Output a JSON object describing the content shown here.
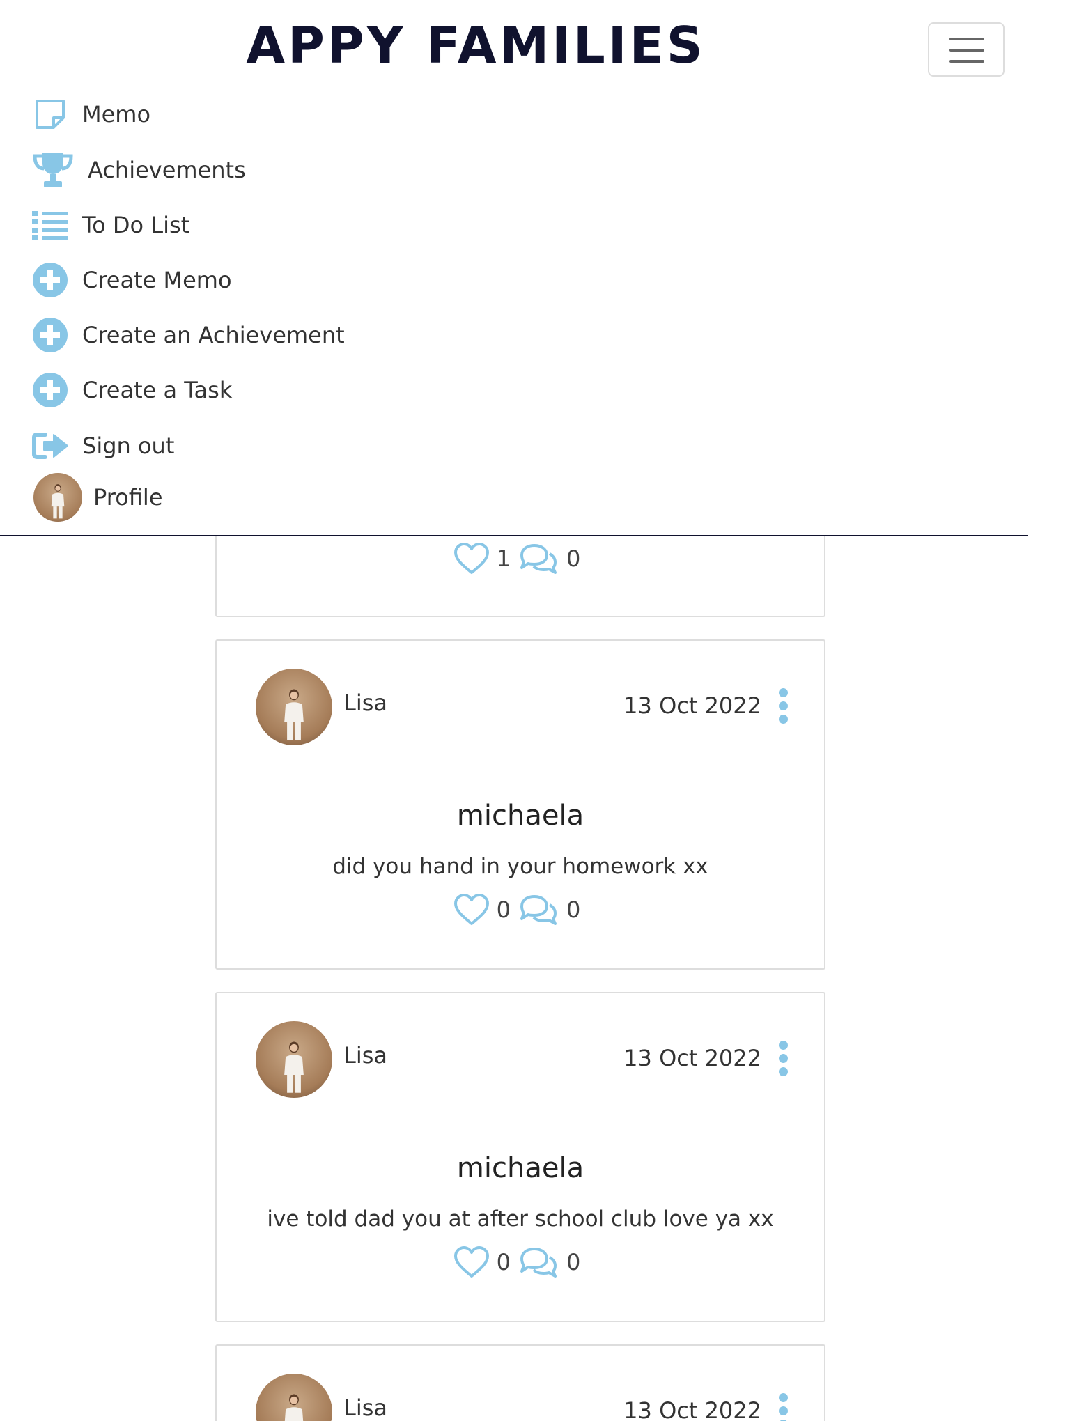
{
  "brand": {
    "title": "APPY FAMILIES"
  },
  "nav": {
    "items": [
      {
        "label": "Memo",
        "icon": "sticky-note-icon"
      },
      {
        "label": "Achievements",
        "icon": "trophy-icon"
      },
      {
        "label": "To Do List",
        "icon": "list-icon"
      },
      {
        "label": "Create Memo",
        "icon": "plus-circle-icon"
      },
      {
        "label": "Create an Achievement",
        "icon": "plus-circle-icon"
      },
      {
        "label": "Create a Task",
        "icon": "plus-circle-icon"
      },
      {
        "label": "Sign out",
        "icon": "sign-out-icon"
      },
      {
        "label": "Profile",
        "icon": "avatar"
      }
    ]
  },
  "colors": {
    "accent": "#88c6e6",
    "brand": "#10122e",
    "border": "#dddddd"
  },
  "posts": [
    {
      "likes": "1",
      "comments": "0"
    },
    {
      "author": "Lisa",
      "date": "13 Oct 2022",
      "title": "michaela",
      "body": "did you hand in your homework xx",
      "likes": "0",
      "comments": "0"
    },
    {
      "author": "Lisa",
      "date": "13 Oct 2022",
      "title": "michaela",
      "body": "ive told dad you at after school club love ya xx",
      "likes": "0",
      "comments": "0"
    },
    {
      "author": "Lisa",
      "date": "13 Oct 2022"
    }
  ]
}
